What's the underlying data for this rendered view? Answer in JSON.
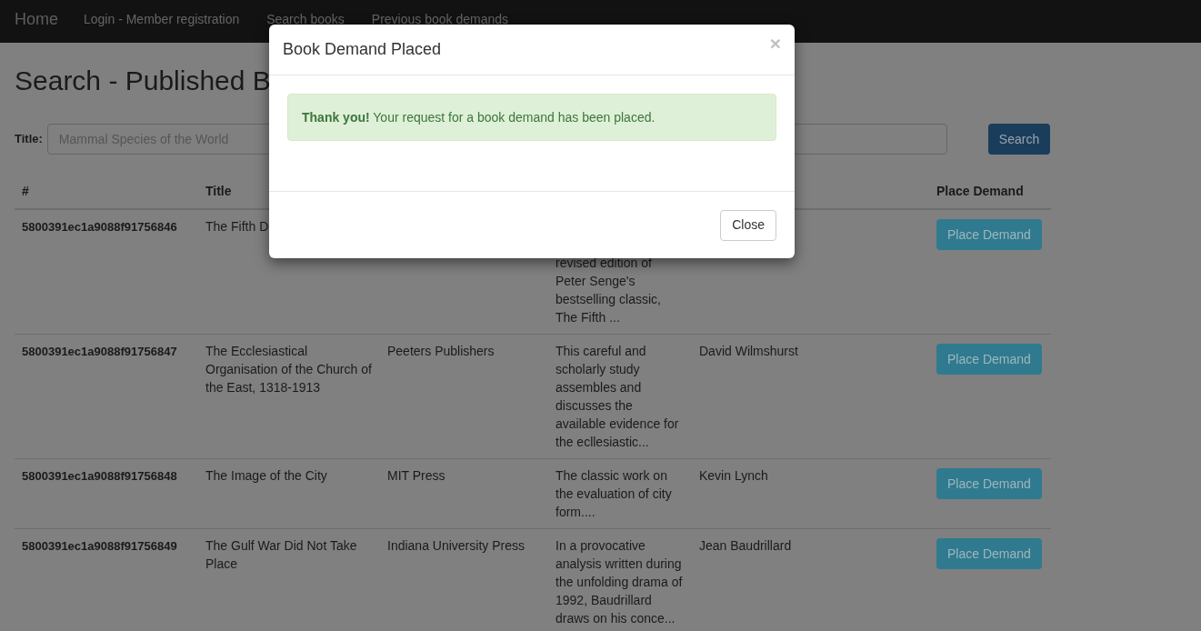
{
  "navbar": {
    "brand": "Home",
    "links": [
      "Login - Member registration",
      "Search books",
      "Previous book demands"
    ]
  },
  "heading": "Search - Published B",
  "search": {
    "title_label": "Title:",
    "title_placeholder": "Mammal Species of the World",
    "button": "Search"
  },
  "table": {
    "columns": [
      "#",
      "Title",
      "Place Demand"
    ],
    "rows": [
      {
        "id": "5800391ec1a9088f91756846",
        "title": "The Fifth D",
        "publisher": "",
        "description": "revised edition of Peter Senge's bestselling classic, The Fifth ...",
        "author": "",
        "action": "Place Demand"
      },
      {
        "id": "5800391ec1a9088f91756847",
        "title": "The Ecclesiastical Organisation of the Church of the East, 1318-1913",
        "publisher": "Peeters Publishers",
        "description": "This careful and scholarly study assembles and discusses the available evidence for the ecllesiastic...",
        "author": "David Wilmshurst",
        "action": "Place Demand"
      },
      {
        "id": "5800391ec1a9088f91756848",
        "title": "The Image of the City",
        "publisher": "MIT Press",
        "description": "The classic work on the evaluation of city form....",
        "author": "Kevin Lynch",
        "action": "Place Demand"
      },
      {
        "id": "5800391ec1a9088f91756849",
        "title": "The Gulf War Did Not Take Place",
        "publisher": "Indiana University Press",
        "description": "In a provocative analysis written during the unfolding drama of 1992, Baudrillard draws on his conce...",
        "author": "Jean Baudrillard",
        "action": "Place Demand"
      }
    ]
  },
  "modal": {
    "title": "Book Demand Placed",
    "close_icon": "×",
    "alert": "**Thank you!** Your request for a book demand has been placed.",
    "button": "Close"
  }
}
